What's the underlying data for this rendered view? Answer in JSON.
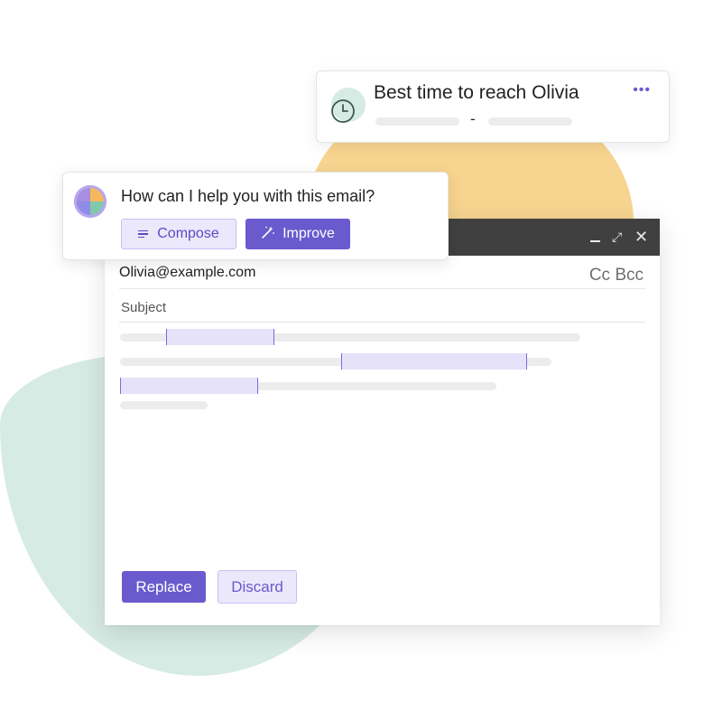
{
  "best_time": {
    "title": "Best time to reach Olivia",
    "separator": "-",
    "icon": "clock-icon",
    "menu_icon": "more-icon"
  },
  "assistant": {
    "question": "How can I help you with this email?",
    "compose_label": "Compose",
    "improve_label": "Improve",
    "compose_icon": "lines-icon",
    "improve_icon": "magic-wand-icon"
  },
  "compose_window": {
    "to": "Olivia@example.com",
    "cc_bcc": "Cc Bcc",
    "subject_placeholder": "Subject",
    "replace_label": "Replace",
    "discard_label": "Discard",
    "window_controls": [
      "minimize-icon",
      "expand-icon",
      "close-icon"
    ]
  },
  "colors": {
    "accent": "#6a5acd",
    "accent_light": "#ebe8fb",
    "blob_green": "#d6ebe3",
    "blob_yellow": "#f7d48f",
    "header_dark": "#404040"
  }
}
